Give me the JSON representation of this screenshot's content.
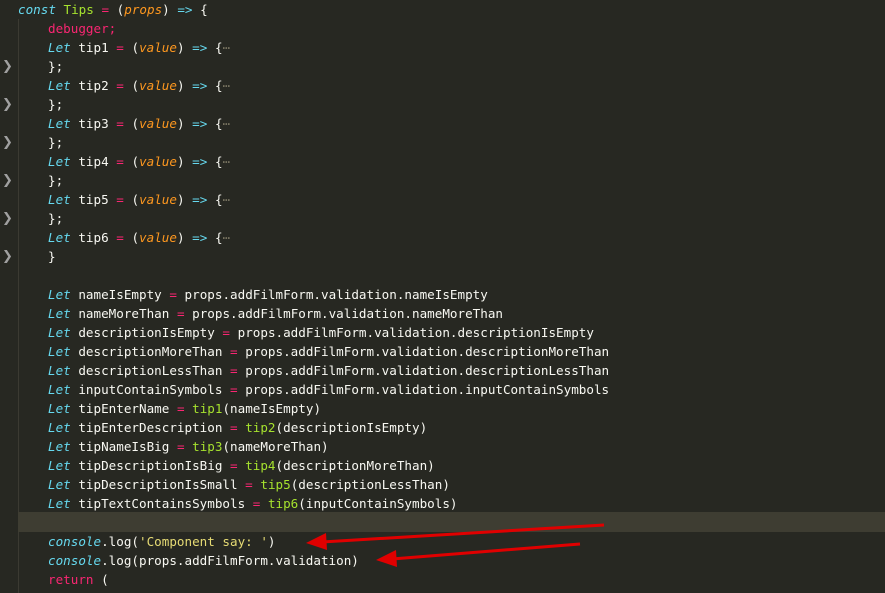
{
  "editor": {
    "line1": {
      "kw": "const",
      "name": "Tips",
      "eq": "=",
      "open": "(",
      "param": "props",
      "close": ")",
      "arrow": "=>",
      "brace": "{"
    },
    "debugger": "debugger;",
    "tips": [
      {
        "kw": "Let",
        "name": "tip1",
        "eq": "=",
        "open": "(",
        "param": "value",
        "close": ")",
        "arrow": "=>",
        "brace": "{",
        "ellipsis": "⋯",
        "end": "};"
      },
      {
        "kw": "Let",
        "name": "tip2",
        "eq": "=",
        "open": "(",
        "param": "value",
        "close": ")",
        "arrow": "=>",
        "brace": "{",
        "ellipsis": "⋯",
        "end": "};"
      },
      {
        "kw": "Let",
        "name": "tip3",
        "eq": "=",
        "open": "(",
        "param": "value",
        "close": ")",
        "arrow": "=>",
        "brace": "{",
        "ellipsis": "⋯",
        "end": "};"
      },
      {
        "kw": "Let",
        "name": "tip4",
        "eq": "=",
        "open": "(",
        "param": "value",
        "close": ")",
        "arrow": "=>",
        "brace": "{",
        "ellipsis": "⋯",
        "end": "};"
      },
      {
        "kw": "Let",
        "name": "tip5",
        "eq": "=",
        "open": "(",
        "param": "value",
        "close": ")",
        "arrow": "=>",
        "brace": "{",
        "ellipsis": "⋯",
        "end": "};"
      },
      {
        "kw": "Let",
        "name": "tip6",
        "eq": "=",
        "open": "(",
        "param": "value",
        "close": ")",
        "arrow": "=>",
        "brace": "{",
        "ellipsis": "⋯",
        "end": "}"
      }
    ],
    "assigns": [
      {
        "kw": "Let",
        "var": "nameIsEmpty",
        "eq": "=",
        "rhs": "props.addFilmForm.validation.nameIsEmpty"
      },
      {
        "kw": "Let",
        "var": "nameMoreThan",
        "eq": "=",
        "rhs": "props.addFilmForm.validation.nameMoreThan"
      },
      {
        "kw": "Let",
        "var": "descriptionIsEmpty",
        "eq": "=",
        "rhs": "props.addFilmForm.validation.descriptionIsEmpty"
      },
      {
        "kw": "Let",
        "var": "descriptionMoreThan",
        "eq": "=",
        "rhs": "props.addFilmForm.validation.descriptionMoreThan"
      },
      {
        "kw": "Let",
        "var": "descriptionLessThan",
        "eq": "=",
        "rhs": "props.addFilmForm.validation.descriptionLessThan"
      },
      {
        "kw": "Let",
        "var": "inputContainSymbols",
        "eq": "=",
        "rhs": "props.addFilmForm.validation.inputContainSymbols"
      }
    ],
    "calls": [
      {
        "kw": "Let",
        "var": "tipEnterName",
        "eq": "=",
        "fn": "tip1",
        "arg": "(nameIsEmpty)"
      },
      {
        "kw": "Let",
        "var": "tipEnterDescription",
        "eq": "=",
        "fn": "tip2",
        "arg": "(descriptionIsEmpty)"
      },
      {
        "kw": "Let",
        "var": "tipNameIsBig",
        "eq": "=",
        "fn": "tip3",
        "arg": "(nameMoreThan)"
      },
      {
        "kw": "Let",
        "var": "tipDescriptionIsBig",
        "eq": "=",
        "fn": "tip4",
        "arg": "(descriptionMoreThan)"
      },
      {
        "kw": "Let",
        "var": "tipDescriptionIsSmall",
        "eq": "=",
        "fn": "tip5",
        "arg": "(descriptionLessThan)"
      },
      {
        "kw": "Let",
        "var": "tipTextContainsSymbols",
        "eq": "=",
        "fn": "tip6",
        "arg": "(inputContainSymbols)"
      }
    ],
    "log1": {
      "obj": "console",
      "dot": ".",
      "fn": "log",
      "open": "(",
      "str": "'Component say: '",
      "close": ")"
    },
    "log2": {
      "obj": "console",
      "dot": ".",
      "fn": "log",
      "arg": "(props.addFilmForm.validation)"
    },
    "ret": {
      "kw": "return",
      "paren": "("
    }
  },
  "colors": {
    "background": "#272822",
    "keyword": "#66d9ef",
    "function": "#a6e22e",
    "operator": "#f92672",
    "parameter": "#fd971f",
    "string": "#e6db74",
    "plain": "#f8f8f2",
    "arrow": "#e00000"
  },
  "icons": {
    "fold": "chevron-right-icon"
  }
}
